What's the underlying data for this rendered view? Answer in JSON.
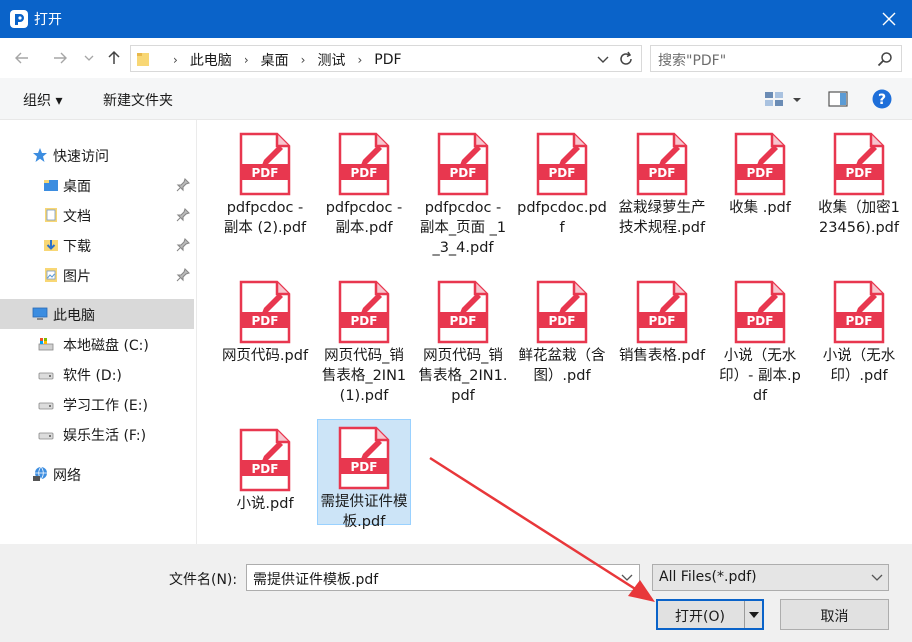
{
  "window": {
    "title": "打开"
  },
  "address": {
    "crumbs": [
      "此电脑",
      "桌面",
      "测试",
      "PDF"
    ]
  },
  "search": {
    "placeholder": "搜索\"PDF\""
  },
  "toolbar": {
    "organize_label": "组织 ▾",
    "new_folder_label": "新建文件夹"
  },
  "sidebar": {
    "quick_access": "快速访问",
    "items": [
      {
        "label": "桌面",
        "icon": "desktop-folder-icon",
        "pinned": true
      },
      {
        "label": "文档",
        "icon": "documents-folder-icon",
        "pinned": true
      },
      {
        "label": "下载",
        "icon": "downloads-folder-icon",
        "pinned": true
      },
      {
        "label": "图片",
        "icon": "pictures-folder-icon",
        "pinned": true
      }
    ],
    "this_pc": "此电脑",
    "drives": [
      {
        "label": "本地磁盘 (C:)",
        "icon": "system-drive-icon"
      },
      {
        "label": "软件 (D:)",
        "icon": "drive-icon"
      },
      {
        "label": "学习工作 (E:)",
        "icon": "drive-icon"
      },
      {
        "label": "娱乐生活 (F:)",
        "icon": "drive-icon"
      }
    ],
    "network": "网络"
  },
  "files": [
    {
      "name": "pdfpcdoc - 副本 (2).pdf"
    },
    {
      "name": "pdfpcdoc - 副本.pdf"
    },
    {
      "name": "pdfpcdoc - 副本_页面 _1_3_4.pdf"
    },
    {
      "name": "pdfpcdoc.pdf"
    },
    {
      "name": "盆栽绿萝生产技术规程.pdf"
    },
    {
      "name": "收集 .pdf"
    },
    {
      "name": "收集（加密123456).pdf"
    },
    {
      "name": "网页代码.pdf"
    },
    {
      "name": "网页代码_销售表格_2IN1(1).pdf"
    },
    {
      "name": "网页代码_销售表格_2IN1.pdf"
    },
    {
      "name": "鲜花盆栽（含图）.pdf"
    },
    {
      "name": "销售表格.pdf"
    },
    {
      "name": "小说（无水印）- 副本.pdf"
    },
    {
      "name": "小说（无水印）.pdf"
    },
    {
      "name": "小说.pdf"
    },
    {
      "name": "需提供证件模板.pdf",
      "selected": true
    }
  ],
  "pdf_badge": "PDF",
  "bottom": {
    "filename_label": "文件名(N):",
    "filename_value": "需提供证件模板.pdf",
    "filter_value": "All Files(*.pdf)",
    "open_label": "打开(O)",
    "cancel_label": "取消"
  },
  "colors": {
    "titlebar": "#0a63c9",
    "pdf_red": "#e8374f",
    "selection": "#cce4f7",
    "annotation_arrow": "#e8373a"
  }
}
